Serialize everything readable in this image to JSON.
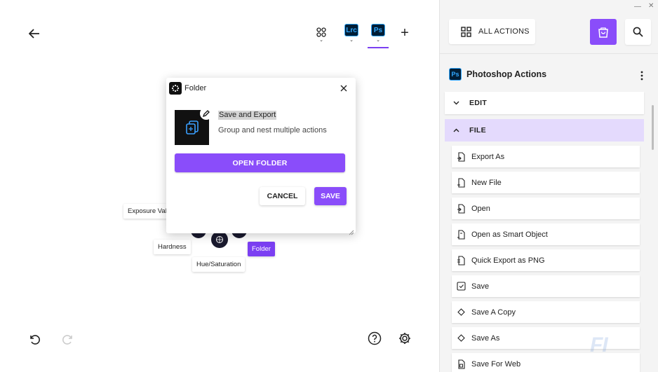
{
  "header": {
    "back_icon": "arrow-left-icon",
    "apps_icon": "grid-icon",
    "tabs": [
      {
        "label": "Lrc",
        "caret": "⌄"
      },
      {
        "label": "Ps",
        "caret": "⌄"
      }
    ],
    "apps_caret": "⌄",
    "add_label": "+"
  },
  "canvas": {
    "chips": {
      "exposure": "Exposure Value",
      "hardness": "Hardness",
      "hue": "Hue/Saturation",
      "folder": "Folder"
    }
  },
  "dialog": {
    "title": "Folder",
    "name": "Save and Export",
    "description": "Group and nest multiple actions",
    "open_folder": "OPEN FOLDER",
    "cancel": "CANCEL",
    "save": "SAVE"
  },
  "panel": {
    "window": {
      "minimize": "—",
      "close": "✕"
    },
    "all_actions": "ALL ACTIONS",
    "app_badge": "Ps",
    "title": "Photoshop Actions",
    "sections": {
      "edit": "EDIT",
      "file": "FILE"
    },
    "actions": [
      {
        "label": "Export As",
        "icon": "export-icon"
      },
      {
        "label": "New File",
        "icon": "new-file-icon"
      },
      {
        "label": "Open",
        "icon": "open-file-icon"
      },
      {
        "label": "Open as Smart Object",
        "icon": "smart-object-icon"
      },
      {
        "label": "Quick Export as PNG",
        "icon": "png-export-icon"
      },
      {
        "label": "Save",
        "icon": "save-icon"
      },
      {
        "label": "Save A Copy",
        "icon": "diamond-icon"
      },
      {
        "label": "Save As",
        "icon": "diamond-icon"
      },
      {
        "label": "Save For Web",
        "icon": "web-save-icon"
      }
    ],
    "watermark": "FI"
  },
  "colors": {
    "accent": "#8a4dfa",
    "ps_blue": "#31a8ff",
    "ps_dark": "#001e36",
    "file_section_bg": "#e4dafd"
  }
}
